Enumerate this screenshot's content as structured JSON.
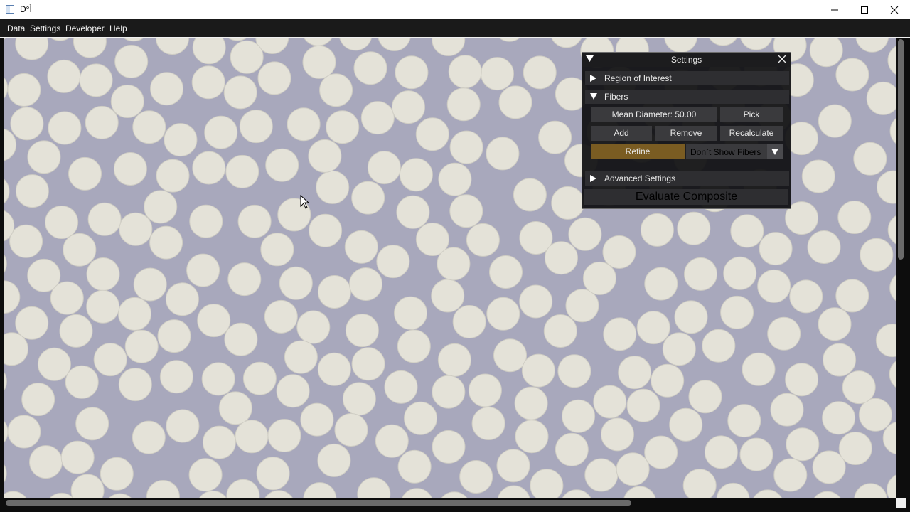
{
  "window": {
    "title": "Ð°Ì",
    "minimize_label": "—",
    "maximize_label": "☐",
    "close_label": "✕"
  },
  "menu": {
    "items": [
      "Data",
      "Settings",
      "Developer",
      "Help"
    ]
  },
  "settings_panel": {
    "title": "Settings",
    "sections": {
      "region_of_interest": "Region of Interest",
      "fibers": "Fibers",
      "advanced": "Advanced Settings"
    },
    "fibers": {
      "mean_diameter": "Mean Diameter: 50.00",
      "pick": "Pick",
      "add": "Add",
      "remove": "Remove",
      "recalculate": "Recalculate",
      "refine": "Refine",
      "show_mode": "Don`t Show Fibers"
    },
    "evaluate": "Evaluate Composite"
  },
  "colors": {
    "matrix": "#a8a8bc",
    "fiber": "#e4e2d8",
    "accent": "#7a5c22"
  },
  "icons": [
    "app-icon",
    "minimize-icon",
    "maximize-icon",
    "close-icon",
    "collapse-triangle-icon",
    "expand-triangle-icon",
    "dropdown-arrow-icon",
    "mouse-cursor-icon"
  ]
}
